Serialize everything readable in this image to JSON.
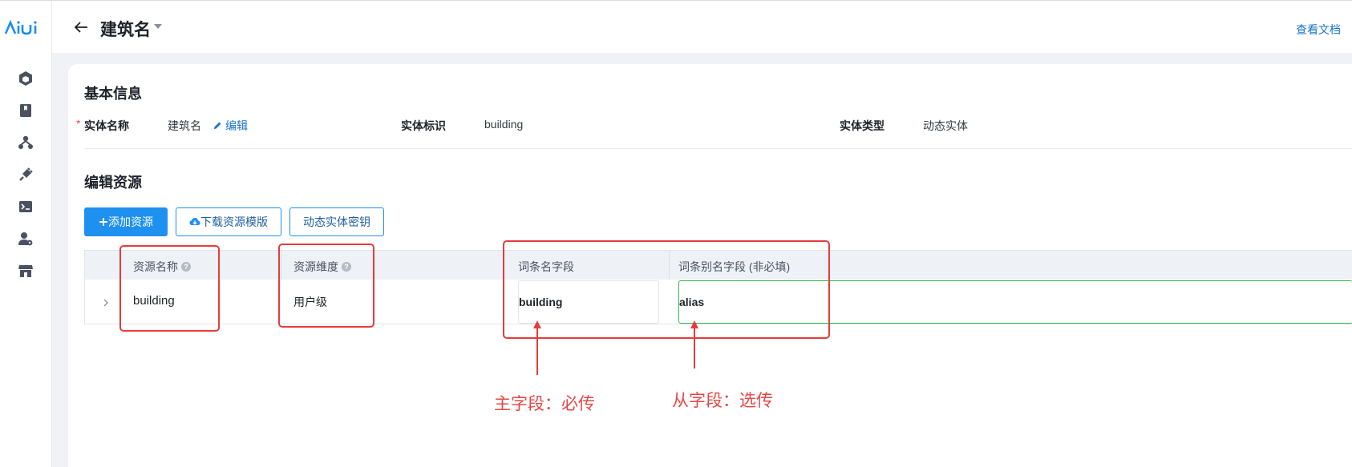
{
  "app": {
    "logo_text": "AIUI"
  },
  "sidebar": {
    "items": [
      {
        "icon": "cube-icon"
      },
      {
        "icon": "book-icon"
      },
      {
        "icon": "network-icon"
      },
      {
        "icon": "plug-icon"
      },
      {
        "icon": "terminal-icon"
      },
      {
        "icon": "user-settings-icon"
      },
      {
        "icon": "store-icon"
      }
    ]
  },
  "header": {
    "title": "建筑名",
    "doc_link": "查看文档"
  },
  "basic_info": {
    "section_title": "基本信息",
    "required_mark": "*",
    "entity_name_label": "实体名称",
    "entity_name_value": "建筑名",
    "edit_label": "编辑",
    "entity_id_label": "实体标识",
    "entity_id_value": "building",
    "entity_type_label": "实体类型",
    "entity_type_value": "动态实体"
  },
  "resources": {
    "section_title": "编辑资源",
    "add_button": "添加资源",
    "download_button": "下载资源模版",
    "secret_button": "动态实体密钥",
    "columns": [
      "资源名称",
      "资源维度",
      "词条名字段",
      "词条别名字段 (非必填)"
    ],
    "rows": [
      {
        "name": "building",
        "dimension": "用户级",
        "term_field": "building",
        "alias_field": "alias"
      }
    ]
  },
  "annotations": {
    "main_field": "主字段：必传",
    "sub_field": "从字段：选传"
  },
  "colors": {
    "primary": "#1e90f0",
    "link": "#1a73c8",
    "annotation_red": "#e63b3b",
    "valid_green": "#38b24f"
  }
}
